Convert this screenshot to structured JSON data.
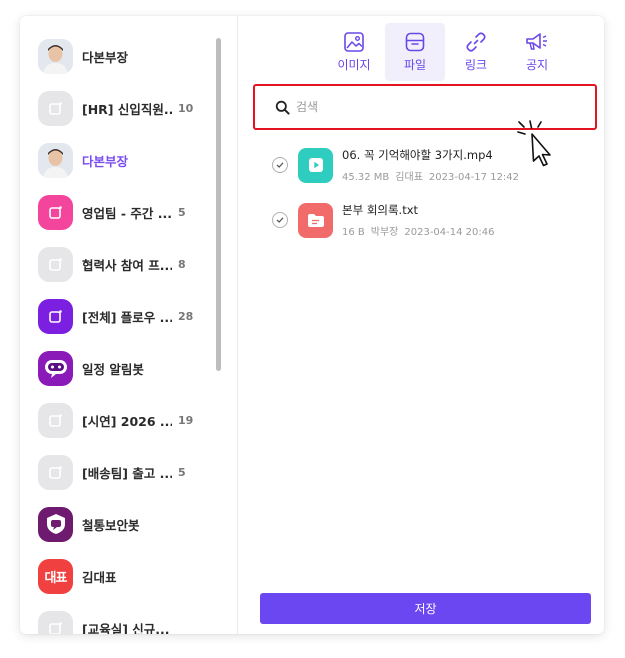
{
  "sidebar": {
    "items": [
      {
        "name": "다본부장",
        "count": "",
        "avatar": "photo",
        "active": false
      },
      {
        "name": "[HR] 신입직원...",
        "count": "10",
        "avatar": "gray",
        "active": false
      },
      {
        "name": "다본부장",
        "count": "",
        "avatar": "photo",
        "active": true
      },
      {
        "name": "영업팀 - 주간 ...",
        "count": "5",
        "avatar": "pink",
        "active": false
      },
      {
        "name": "협력사 참여 프...",
        "count": "8",
        "avatar": "gray",
        "active": false
      },
      {
        "name": "[전체] 플로우 ...",
        "count": "28",
        "avatar": "purple",
        "active": false
      },
      {
        "name": "일정 알림봇",
        "count": "",
        "avatar": "bot",
        "active": false
      },
      {
        "name": "[시연] 2026 ...",
        "count": "19",
        "avatar": "gray",
        "active": false
      },
      {
        "name": "[배송팀] 출고 ...",
        "count": "5",
        "avatar": "gray",
        "active": false
      },
      {
        "name": "철통보안봇",
        "count": "",
        "avatar": "plum",
        "active": false
      },
      {
        "name": "김대표",
        "count": "",
        "avatar": "red",
        "avatar_text": "대표",
        "active": false
      },
      {
        "name": "[교육실] 신규...",
        "count": "",
        "avatar": "gray",
        "active": false
      }
    ]
  },
  "tabs": [
    {
      "label": "이미지",
      "icon": "image-icon"
    },
    {
      "label": "파일",
      "icon": "file-icon",
      "active": true
    },
    {
      "label": "링크",
      "icon": "link-icon"
    },
    {
      "label": "공지",
      "icon": "megaphone-icon"
    }
  ],
  "search": {
    "placeholder": "검색",
    "value": ""
  },
  "files": [
    {
      "name": "06. 꼭 기억해야할 3가지.mp4",
      "size": "45.32 MB",
      "owner": "김대표",
      "date": "2023-04-17 12:42",
      "type": "video"
    },
    {
      "name": "본부 회의록.txt",
      "size": "16 B",
      "owner": "박부장",
      "date": "2023-04-14 20:46",
      "type": "doc"
    }
  ],
  "save_label": "저장",
  "colors": {
    "accent": "#6a47f0",
    "highlight": "#e3131f",
    "teal": "#2fcdbf",
    "coral": "#f16b6b"
  }
}
